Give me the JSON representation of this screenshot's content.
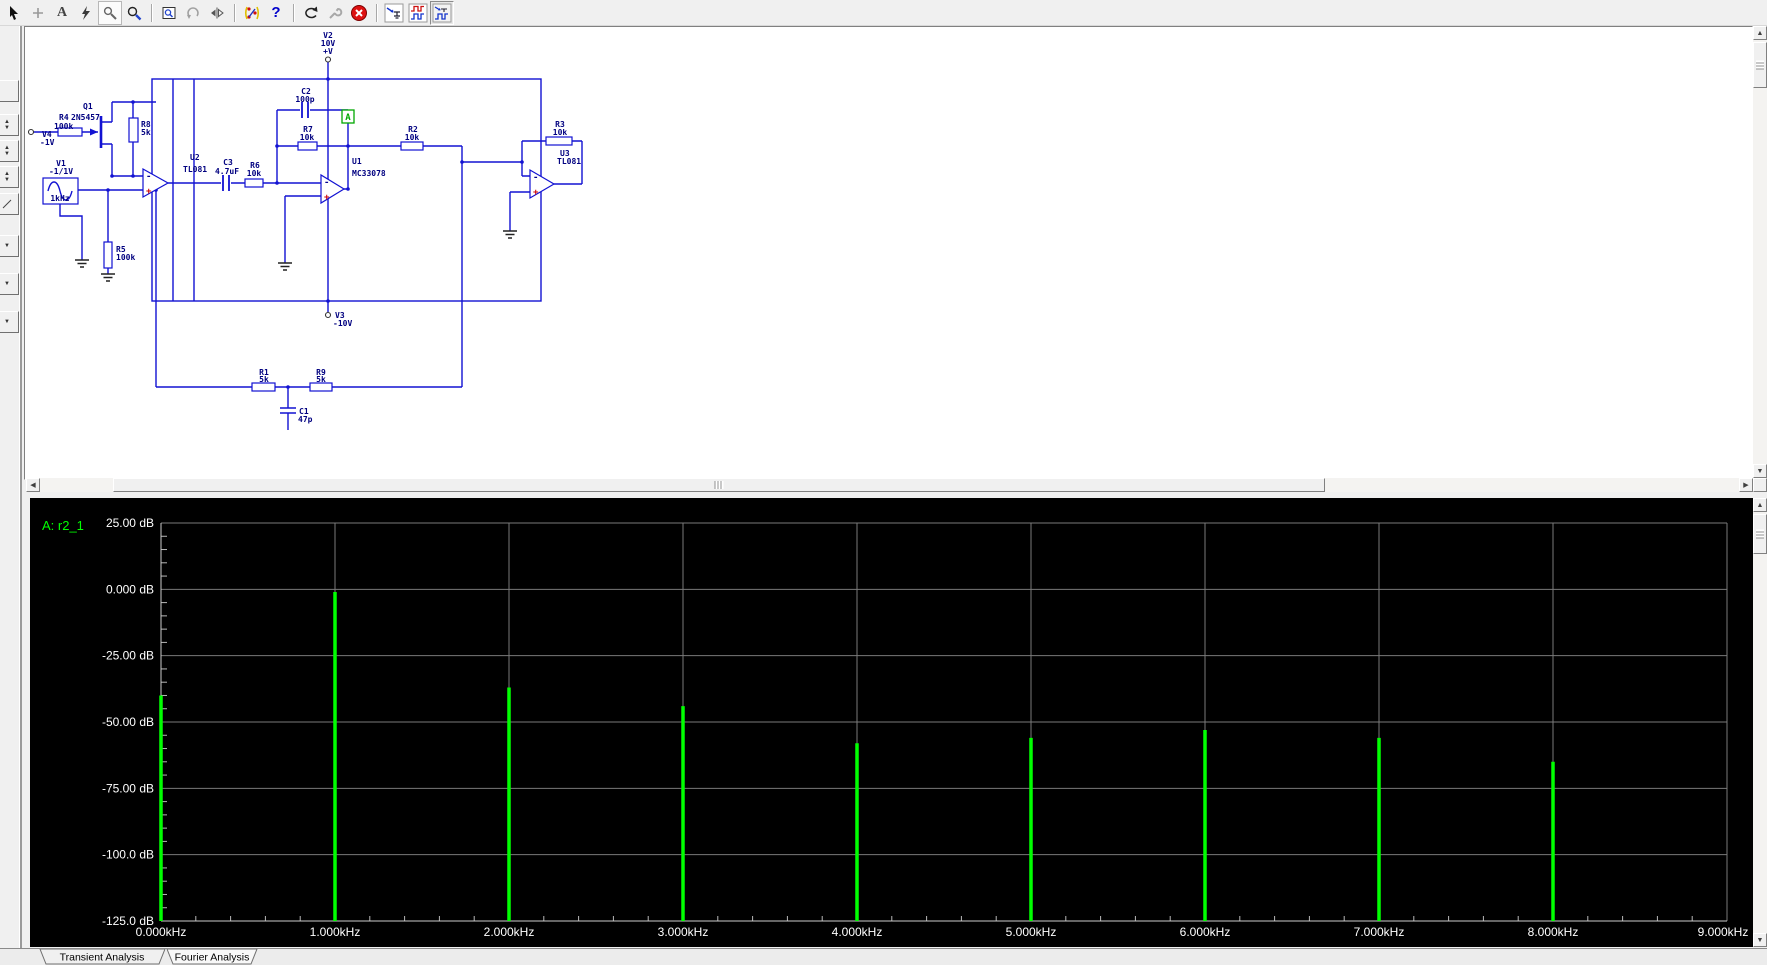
{
  "icons": {
    "up": "▲",
    "down": "▼",
    "left": "◀",
    "right": "▶"
  },
  "toolbar": {
    "text_tool_label": "A",
    "help_label": "?"
  },
  "sch": {
    "v2": "V2",
    "v2_val": "10V",
    "v2_pin": "+V",
    "v3": "V3",
    "v3_val": "-10V",
    "v4": "V4",
    "v4_val": "-1V",
    "v1": "V1",
    "v1_val": "-1/1V",
    "v1_freq": "1kHz",
    "q1": "Q1",
    "q1_part": "2N5457",
    "r4": "R4",
    "r4_val": "100k",
    "r8": "R8",
    "r8_val": "5k",
    "r5": "R5",
    "r5_val": "100k",
    "u2": "U2",
    "u2_part": "TL081",
    "c3": "C3",
    "c3_val": "4.7uF",
    "r6": "R6",
    "r6_val": "10k",
    "c2": "C2",
    "c2_val": "100p",
    "r7": "R7",
    "r7_val": "10k",
    "u1": "U1",
    "u1_part": "MC33078",
    "probe_a": "A",
    "r2": "R2",
    "r2_val": "10k",
    "r3": "R3",
    "r3_val": "10k",
    "u3": "U3",
    "u3_part": "TL081",
    "r1": "R1",
    "r1_val": "5k",
    "r9": "R9",
    "r9_val": "5k",
    "c1": "C1",
    "c1_val": "47p",
    "minus": "-",
    "plus": "+"
  },
  "chart_data": {
    "type": "bar",
    "title": "Fourier Analysis",
    "series": [
      {
        "name": "A: r2_1",
        "color": "#00ff00",
        "points": [
          [
            0,
            -40
          ],
          [
            1,
            -1
          ],
          [
            2,
            -37
          ],
          [
            3,
            -44
          ],
          [
            4,
            -58
          ],
          [
            5,
            -56
          ],
          [
            6,
            -53
          ],
          [
            7,
            -56
          ],
          [
            8,
            -65
          ]
        ]
      }
    ],
    "x_unit": "kHz",
    "y_unit": "dB",
    "xlim": [
      0,
      9
    ],
    "ylim": [
      -125,
      25
    ],
    "baseline": -125,
    "grid": true,
    "y_ticks": [
      {
        "v": 25,
        "label": "25.00 dB"
      },
      {
        "v": 0,
        "label": "0.000 dB"
      },
      {
        "v": -25,
        "label": "-25.00 dB"
      },
      {
        "v": -50,
        "label": "-50.00 dB"
      },
      {
        "v": -75,
        "label": "-75.00 dB"
      },
      {
        "v": -100,
        "label": "-100.0 dB"
      },
      {
        "v": -125,
        "label": "-125.0 dB"
      }
    ],
    "x_ticks": [
      {
        "v": 0,
        "label": "0.000kHz"
      },
      {
        "v": 1,
        "label": "1.000kHz"
      },
      {
        "v": 2,
        "label": "2.000kHz"
      },
      {
        "v": 3,
        "label": "3.000kHz"
      },
      {
        "v": 4,
        "label": "4.000kHz"
      },
      {
        "v": 5,
        "label": "5.000kHz"
      },
      {
        "v": 6,
        "label": "6.000kHz"
      },
      {
        "v": 7,
        "label": "7.000kHz"
      },
      {
        "v": 8,
        "label": "8.000kHz"
      },
      {
        "v": 9,
        "label": "9.000kHz"
      }
    ],
    "minor_x_step": 0.2,
    "minor_y_step": 5,
    "bg": "#000000",
    "grid_color": "#7a7a7a",
    "axis_color": "#cccccc",
    "text_color": "#ffffff"
  },
  "tabs": {
    "items": [
      {
        "label": "Transient Analysis",
        "active": false
      },
      {
        "label": "Fourier Analysis",
        "active": true
      }
    ]
  }
}
